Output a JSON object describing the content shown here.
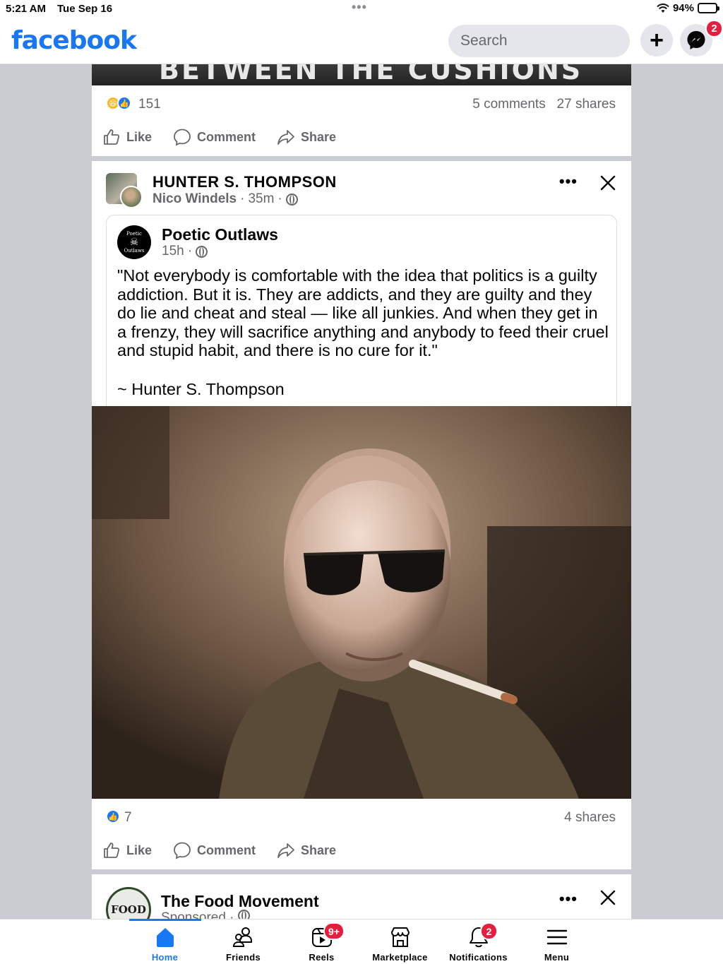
{
  "status_bar": {
    "time": "5:21 AM",
    "date": "Tue Sep 16",
    "battery": "94%"
  },
  "header": {
    "logo": "facebook",
    "search_placeholder": "Search",
    "messenger_badge": "2"
  },
  "post_top": {
    "image_text": "BETWEEN THE CUSHIONS",
    "reactions": [
      "haha",
      "like"
    ],
    "reaction_count": "151",
    "comments": "5 comments",
    "shares": "27 shares",
    "actions": {
      "like": "Like",
      "comment": "Comment",
      "share": "Share"
    }
  },
  "post_main": {
    "group_name": "HUNTER S. THOMPSON",
    "author": "Nico Windels",
    "time": "35m",
    "separator": "·",
    "shared_post": {
      "page_name": "Poetic Outlaws",
      "avatar_text_top": "Poetic",
      "avatar_text_bottom": "Outlaws",
      "time": "15h",
      "quote": "\"Not everybody is comfortable with the idea that politics is a guilty addiction. But it is. They are addicts, and they are guilty and they do lie and cheat and steal — like all junkies. And when they get in a frenzy, they will sacrifice anything and anybody to feed their cruel and stupid habit, and there is no cure for it.\"",
      "attribution": "~ Hunter S. Thompson"
    },
    "reaction_count": "7",
    "shares": "4 shares",
    "actions": {
      "like": "Like",
      "comment": "Comment",
      "share": "Share"
    }
  },
  "post_sponsored": {
    "page_name": "The Food Movement",
    "avatar_text": "FOOD",
    "meta": "Sponsored · "
  },
  "tabbar": {
    "tabs": [
      {
        "label": "Home",
        "active": true
      },
      {
        "label": "Friends"
      },
      {
        "label": "Reels",
        "badge": "9+"
      },
      {
        "label": "Marketplace"
      },
      {
        "label": "Notifications",
        "badge": "2"
      },
      {
        "label": "Menu"
      }
    ]
  },
  "colors": {
    "brand": "#1877f2",
    "badge": "#e41e3f",
    "secondary_text": "#65676b",
    "feed_bg": "#c9ccd1"
  }
}
